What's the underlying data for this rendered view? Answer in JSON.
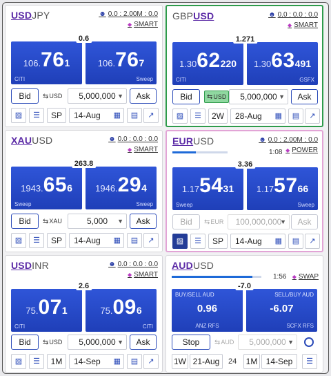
{
  "tiles": [
    {
      "base": "USD",
      "quote": "JPY",
      "qty": "0.0 : 2.00M : 0.0",
      "venue": "SMART",
      "spread": "0.6",
      "bid": {
        "pre": "106.",
        "main": "76",
        "pip": "1",
        "src": "CITI"
      },
      "ask": {
        "pre": "106.",
        "main": "76",
        "pip": "7",
        "src": "Sweep"
      },
      "bid_label": "Bid",
      "ask_label": "Ask",
      "ccy": "USD",
      "amount": "5,000,000",
      "tenor": "SP",
      "date": "14-Aug"
    },
    {
      "base": "GBP",
      "quote": "USD",
      "qty": "0.0 : 0.0 : 0.0",
      "venue": "SMART",
      "spread": "1.271",
      "bid": {
        "pre": "1.30",
        "main": "62",
        "pip": "220",
        "src": "CITI"
      },
      "ask": {
        "pre": "1.30",
        "main": "63",
        "pip": "491",
        "src": "GSFX"
      },
      "bid_label": "Bid",
      "ask_label": "Ask",
      "ccy": "USD",
      "amount": "5,000,000",
      "tenor": "2W",
      "date": "28-Aug"
    },
    {
      "base": "XAU",
      "quote": "USD",
      "qty": "0.0 : 0.0 : 0.0",
      "venue": "SMART",
      "spread": "263.8",
      "bid": {
        "pre": "1943.",
        "main": "65",
        "pip": "6",
        "src": "Sweep"
      },
      "ask": {
        "pre": "1946.",
        "main": "29",
        "pip": "4",
        "src": "Sweep"
      },
      "bid_label": "Bid",
      "ask_label": "Ask",
      "ccy": "XAU",
      "amount": "5,000",
      "tenor": "SP",
      "date": "14-Aug"
    },
    {
      "base": "EUR",
      "quote": "USD",
      "qty": "0.0 : 2.00M : 0.0",
      "venue": "POWER",
      "timer": "1:08",
      "progress": 0.42,
      "spread": "3.36",
      "bid": {
        "pre": "1.17",
        "main": "54",
        "pip": "31",
        "src": "Sweep"
      },
      "ask": {
        "pre": "1.17",
        "main": "57",
        "pip": "66",
        "src": "Sweep"
      },
      "bid_label": "Bid",
      "ask_label": "Ask",
      "ccy": "EUR",
      "amount": "100,000,000",
      "tenor": "SP",
      "date": "14-Aug"
    },
    {
      "base": "USD",
      "quote": "INR",
      "qty": "0.0 : 0.0 : 0.0",
      "venue": "SMART",
      "spread": "2.6",
      "bid": {
        "pre": "75.",
        "main": "07",
        "pip": "1",
        "src": "CITI"
      },
      "ask": {
        "pre": "75.",
        "main": "09",
        "pip": "6",
        "src": "CITI"
      },
      "bid_label": "Bid",
      "ask_label": "Ask",
      "ccy": "USD",
      "amount": "5,000,000",
      "tenor": "1M",
      "date": "14-Sep"
    },
    {
      "base": "AUD",
      "quote": "USD",
      "venue": "SWAP",
      "timer": "1:56",
      "progress": 0.9,
      "spread": "-7.0",
      "left_header": "BUY/SELL AUD",
      "left_value": "0.96",
      "left_src": "ANZ RFS",
      "right_header": "SELL/BUY AUD",
      "right_value": "-6.07",
      "right_src": "SCFX RFS",
      "stop_label": "Stop",
      "ccy": "AUD",
      "amount": "5,000,000",
      "near_tenor": "1W",
      "near_date": "21-Aug",
      "days": "24",
      "far_tenor": "1M",
      "far_date": "14-Sep"
    }
  ]
}
